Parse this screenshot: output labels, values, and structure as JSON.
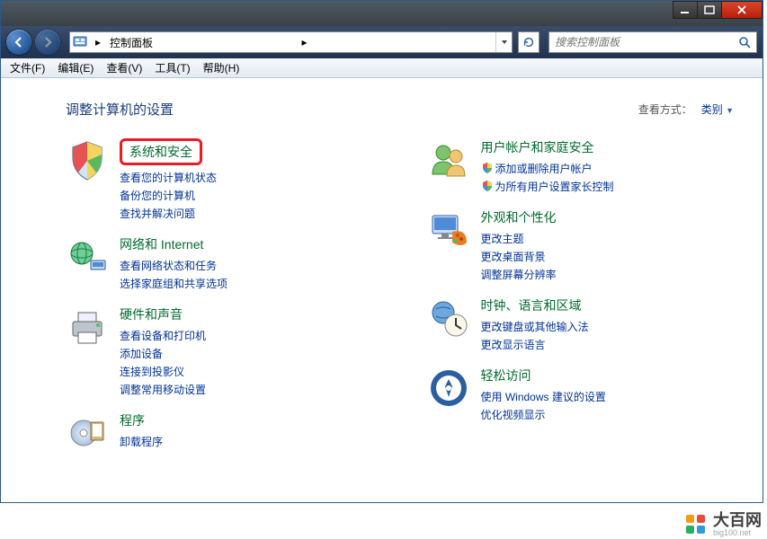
{
  "titlebar": {},
  "nav": {
    "path_text": "控制面板",
    "path_sep": "▸",
    "search_placeholder": "搜索控制面板"
  },
  "menu": {
    "file": "文件(F)",
    "edit": "编辑(E)",
    "view": "查看(V)",
    "tools": "工具(T)",
    "help": "帮助(H)"
  },
  "content": {
    "heading": "调整计算机的设置",
    "viewmode_label": "查看方式：",
    "viewmode_value": "类别"
  },
  "cats": {
    "system": {
      "title": "系统和安全",
      "links": [
        "查看您的计算机状态",
        "备份您的计算机",
        "查找并解决问题"
      ]
    },
    "network": {
      "title": "网络和 Internet",
      "links": [
        "查看网络状态和任务",
        "选择家庭组和共享选项"
      ]
    },
    "hardware": {
      "title": "硬件和声音",
      "links": [
        "查看设备和打印机",
        "添加设备",
        "连接到投影仪",
        "调整常用移动设置"
      ]
    },
    "programs": {
      "title": "程序",
      "links": [
        "卸载程序"
      ]
    },
    "users": {
      "title": "用户帐户和家庭安全",
      "links": [
        "添加或删除用户帐户",
        "为所有用户设置家长控制"
      ],
      "shield": [
        true,
        true
      ]
    },
    "appearance": {
      "title": "外观和个性化",
      "links": [
        "更改主题",
        "更改桌面背景",
        "调整屏幕分辨率"
      ]
    },
    "clock": {
      "title": "时钟、语言和区域",
      "links": [
        "更改键盘或其他输入法",
        "更改显示语言"
      ]
    },
    "ease": {
      "title": "轻松访问",
      "links": [
        "使用 Windows 建议的设置",
        "优化视频显示"
      ]
    }
  },
  "watermark": {
    "name": "大百网",
    "url": "big100.net"
  }
}
